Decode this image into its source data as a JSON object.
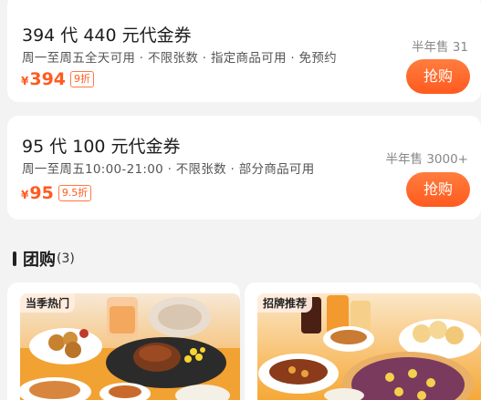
{
  "vouchers": [
    {
      "title": "394 代 440 元代金券",
      "desc": "周一至周五全天可用 · 不限张数 · 指定商品可用 · 免预约",
      "currency": "¥",
      "price": "394",
      "discount": "9折",
      "sold": "半年售 31",
      "buy_label": "抢购"
    },
    {
      "title": "95 代 100 元代金券",
      "desc": "周一至周五10:00-21:00 · 不限张数 · 部分商品可用",
      "currency": "¥",
      "price": "95",
      "discount": "9.5折",
      "sold": "半年售 3000+",
      "buy_label": "抢购"
    }
  ],
  "group_section": {
    "title": "团购",
    "count": "(3)"
  },
  "group_items": [
    {
      "tag": "当季热门",
      "image": "steak-set-photo"
    },
    {
      "tag": "招牌推荐",
      "image": "pizza-set-photo"
    }
  ],
  "colors": {
    "accent": "#ff5a1f",
    "background": "#f3f3f3",
    "card": "#ffffff"
  }
}
